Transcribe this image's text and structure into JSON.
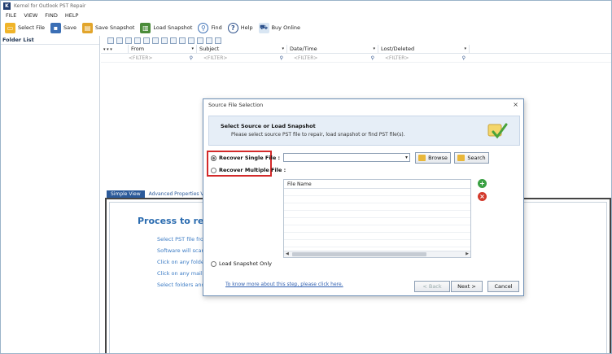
{
  "app": {
    "title": "Kernel for Outlook PST Repair",
    "logo_letter": "K",
    "colors": {
      "accent": "#2b5a9a",
      "highlight_border": "#d32a2a",
      "link": "#2f5fb0"
    }
  },
  "menu": [
    "FILE",
    "VIEW",
    "FIND",
    "HELP"
  ],
  "toolbar": {
    "select_file": "Select File",
    "save": "Save",
    "save_snapshot": "Save Snapshot",
    "load_snapshot": "Load Snapshot",
    "find": "Find",
    "help": "Help",
    "buy_online": "Buy Online"
  },
  "folder_list": {
    "header": "Folder List"
  },
  "grid": {
    "columns": [
      "From",
      "Subject",
      "Date/Time",
      "Lost/Deleted"
    ],
    "filter_placeholder": "<FILTER>"
  },
  "view_tabs": {
    "simple": "Simple View",
    "advanced": "Advanced Properties V"
  },
  "simple_view": {
    "title": "Process to repai",
    "steps": [
      "Select PST file from",
      "Software will scan s",
      "Click on any folder i",
      "Click on any mail to",
      "Select folders and c"
    ]
  },
  "dialog": {
    "title": "Source File Selection",
    "close_glyph": "×",
    "banner_title": "Select Source or Load Snapshot",
    "banner_subtitle": "Please select source PST file to repair, load snapshot or find PST file(s).",
    "recover_single": "Recover Single File :",
    "recover_multiple": "Recover Multiple File :",
    "browse": "Browse",
    "search": "Search",
    "file_list_header": "File Name",
    "load_snapshot_only": "Load Snapshot Only",
    "help_link": "To know more about this step, please click here.",
    "back": "< Back",
    "next": "Next >",
    "cancel": "Cancel"
  }
}
